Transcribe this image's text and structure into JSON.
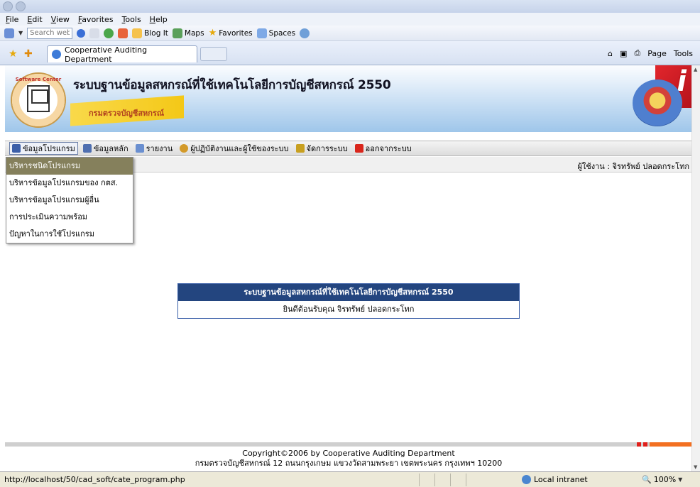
{
  "browser": {
    "menu": [
      "File",
      "Edit",
      "View",
      "Favorites",
      "Tools",
      "Help"
    ],
    "search_placeholder": "Search web",
    "toolbar": [
      "Blog It",
      "Maps",
      "Favorites",
      "Spaces"
    ],
    "tab_title": "Cooperative Auditing Department",
    "commands": [
      "Page",
      "Tools"
    ],
    "status_url": "http://localhost/50/cad_soft/cate_program.php",
    "zone": "Local intranet",
    "zoom": "100%"
  },
  "banner": {
    "title": "ระบบฐานข้อมูลสหกรณ์ที่ใช้เทคโนโลยีการบัญชีสหกรณ์ 2550",
    "tag": "กรมตรวจบัญชีสหกรณ์",
    "logo_text": "Software Center"
  },
  "app_menu": [
    {
      "label": "ข้อมูลโปรแกรม",
      "icon": "monitor-icon",
      "color": "#3c5fa8"
    },
    {
      "label": "ข้อมูลหลัก",
      "icon": "computer-user-icon",
      "color": "#4f6fb0"
    },
    {
      "label": "รายงาน",
      "icon": "report-icon",
      "color": "#6a8fd0"
    },
    {
      "label": "ผู้ปฏิบัติงานและผู้ใช้ของระบบ",
      "icon": "users-icon",
      "color": "#d39a2a"
    },
    {
      "label": "จัดการระบบ",
      "icon": "keys-icon",
      "color": "#c8a020"
    },
    {
      "label": "ออกจากระบบ",
      "icon": "exit-icon",
      "color": "#d9261c"
    }
  ],
  "dropdown": [
    "บริหารชนิดโปรแกรม",
    "บริหารข้อมูลโปรแกรมของ กตส.",
    "บริหารข้อมูลโปรแกรมผู้อื่น",
    "การประเมินความพร้อม",
    "ปัญหาในการใช้โปรแกรม"
  ],
  "user": "ผู้ใช้งาน : จิรทรัพย์ ปลอดกระโทก",
  "welcome": {
    "title": "ระบบฐานข้อมูลสหกรณ์ที่ใช้เทคโนโลยีการบัญชีสหกรณ์ 2550",
    "message": "ยินดีต้อนรับคุณ จิรทรัพย์ ปลอดกระโทก"
  },
  "footer": {
    "line1": "Copyright©2006 by Cooperative Auditing Department",
    "line2": "กรมตรวจบัญชีสหกรณ์ 12 ถนนกรุงเกษม แขวงวัดสามพระยา เขตพระนคร กรุงเทพฯ 10200"
  }
}
